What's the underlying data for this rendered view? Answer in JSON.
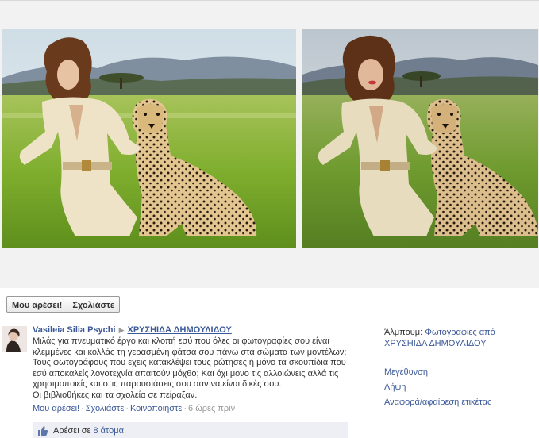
{
  "photos": {
    "left_alt": "Woman in cream safari outfit kneeling beside a cheetah in tall grass",
    "right_alt": "Retouched version of the same photo of the woman and the cheetah"
  },
  "actions": {
    "like_label": "Μου αρέσει!",
    "comment_label": "Σχολιάστε"
  },
  "comment": {
    "author": "Vasileia Silia Psychi",
    "target": "ΧΡΥΣΗΙΔΑ ΔΗΜΟΥΛΙΔΟΥ",
    "lines": [
      "Μιλάς για πνευματικό έργο και κλοπή εσύ που όλες οι φωτογραφίες σου είναι κλεμμένες και κολλάς τη γερασμένη φάτσα σου πάνω στα σώματα των μοντέλων; Τους φωτογράφους που εχεις κατακλέψει τους ρώτησες ή μόνο τα σκουπίδια που εσύ αποκαλείς λογοτεχνία απαιτούν μόχθο; Και όχι μονο τις αλλοιώνεις αλλά τις χρησιμοποιείς και στις παρουσιάσεις σου σαν να είναι δικές σου.",
      "Οι βιβλιοθήκες και τα σχολεία σε πείραξαν."
    ],
    "meta": {
      "like": "Μου αρέσει!",
      "reply": "Σχολιάστε",
      "share": "Κοινοποιήστε",
      "time": "6 ώρες πριν"
    }
  },
  "likes": {
    "prefix": "Αρέσει σε",
    "count_text": "8 άτομα",
    "suffix": "."
  },
  "sidebar": {
    "album_label": "Άλμπουμ:",
    "album_name": "Φωτογραφίες από ΧΡΥΣΗΙΔΑ ΔΗΜΟΥΛΙΔΟΥ",
    "enlarge": "Μεγέθυνση",
    "download": "Λήψη",
    "tag": "Αναφορά/αφαίρεση ετικέτας"
  }
}
